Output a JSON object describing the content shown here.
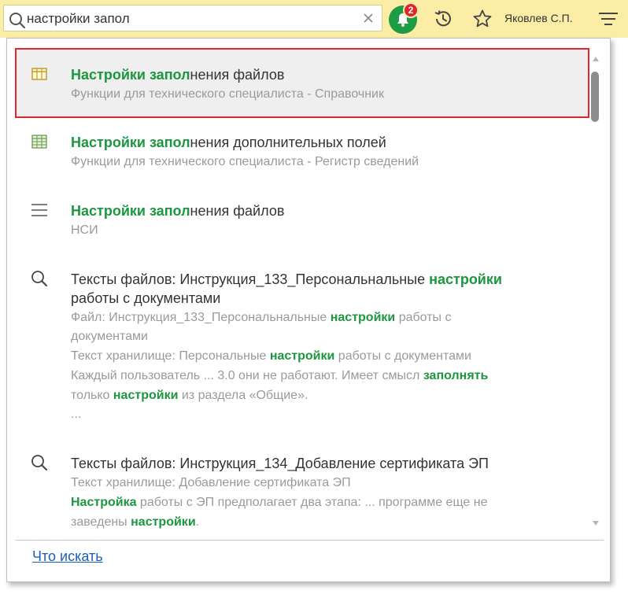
{
  "search": {
    "value": "настройки запол",
    "placeholder": ""
  },
  "toolbar": {
    "notification_count": "2",
    "user_name": "Яковлев С.П."
  },
  "colors": {
    "topbar": "#fbeda5",
    "highlight_text": "#1d9640",
    "selected_border": "#e0262d",
    "link": "#1b5fb8"
  },
  "results": [
    {
      "icon": "table-icon",
      "title_match": "Настройки запол",
      "title_rest": "нения файлов",
      "subtitle": "Функции для технического специалиста - Справочник"
    },
    {
      "icon": "register-icon",
      "title_match": "Настройки запол",
      "title_rest": "нения дополнительных полей",
      "subtitle": "Функции для технического специалиста - Регистр сведений"
    },
    {
      "icon": "list-icon",
      "title_match": "Настройки запол",
      "title_rest": "нения файлов",
      "subtitle": "НСИ"
    },
    {
      "icon": "search-icon",
      "title_line1_a": "Тексты файлов: Инструкция_133_Персональнальные ",
      "title_line1_hl": "настройки",
      "title_line2": "работы с документами",
      "line1_a": "Файл: Инструкция_133_Персональнальные ",
      "line1_hl": "настройки",
      "line1_b": " работы с",
      "line2": "документами",
      "line3_a": "Текст хранилище: Персональные ",
      "line3_hl": "настройки",
      "line3_b": " работы с документами",
      "line4_a": "Каждый пользователь ... 3.0  они не работают. Имеет смысл ",
      "line4_hl": "заполнять",
      "line5_a": "только ",
      "line5_hl": "настройки",
      "line5_b": " из раздела «Общие».",
      "line6": "..."
    },
    {
      "icon": "search-icon",
      "title": "Тексты файлов: Инструкция_134_Добавление сертификата ЭП",
      "line1": "Текст хранилище: Добавление сертификата ЭП",
      "line2_hl": "Настройка",
      "line2_b": " работы с ЭП предполагает два этапа: ... программе еще не",
      "line3_a": "заведены ",
      "line3_hl": "настройки",
      "line3_b": "."
    }
  ],
  "footer": {
    "link_label": "Что искать"
  }
}
